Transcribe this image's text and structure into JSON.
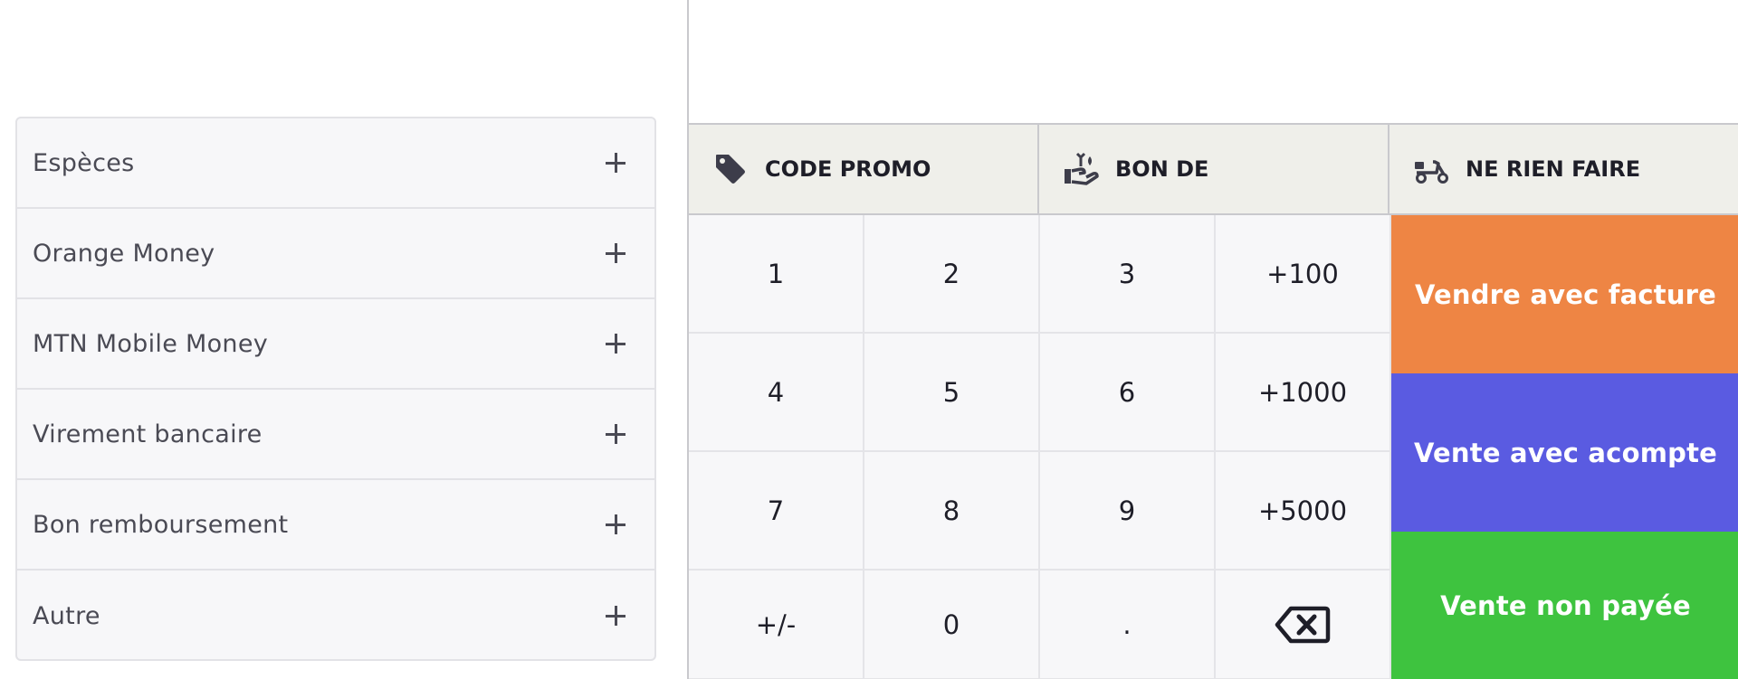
{
  "payment_methods": [
    {
      "label": "Espèces"
    },
    {
      "label": "Orange Money"
    },
    {
      "label": "MTN Mobile Money"
    },
    {
      "label": "Virement bancaire"
    },
    {
      "label": "Bon remboursement"
    },
    {
      "label": "Autre"
    }
  ],
  "actions": {
    "promo": {
      "label": "CODE PROMO",
      "icon": "tag-icon"
    },
    "refund": {
      "label": "BON DE REMBOURSEMENT",
      "icon": "hand-coins-icon"
    },
    "nothing": {
      "label": "NE RIEN FAIRE",
      "icon": "scooter-icon"
    }
  },
  "keypad": {
    "k1": "1",
    "k2": "2",
    "k3": "3",
    "k100": "+100",
    "k4": "4",
    "k5": "5",
    "k6": "6",
    "k1000": "+1000",
    "k7": "7",
    "k8": "8",
    "k9": "9",
    "k5000": "+5000",
    "sign": "+/-",
    "k0": "0",
    "dot": ".",
    "backspace_icon": "backspace-icon"
  },
  "sales": {
    "invoice": {
      "label": "Vendre avec facture",
      "color": "#ee8544"
    },
    "deposit": {
      "label": "Vente avec acompte",
      "color": "#5a5be1"
    },
    "unpaid": {
      "label": "Vente non payée",
      "color": "#3ec33f"
    }
  }
}
